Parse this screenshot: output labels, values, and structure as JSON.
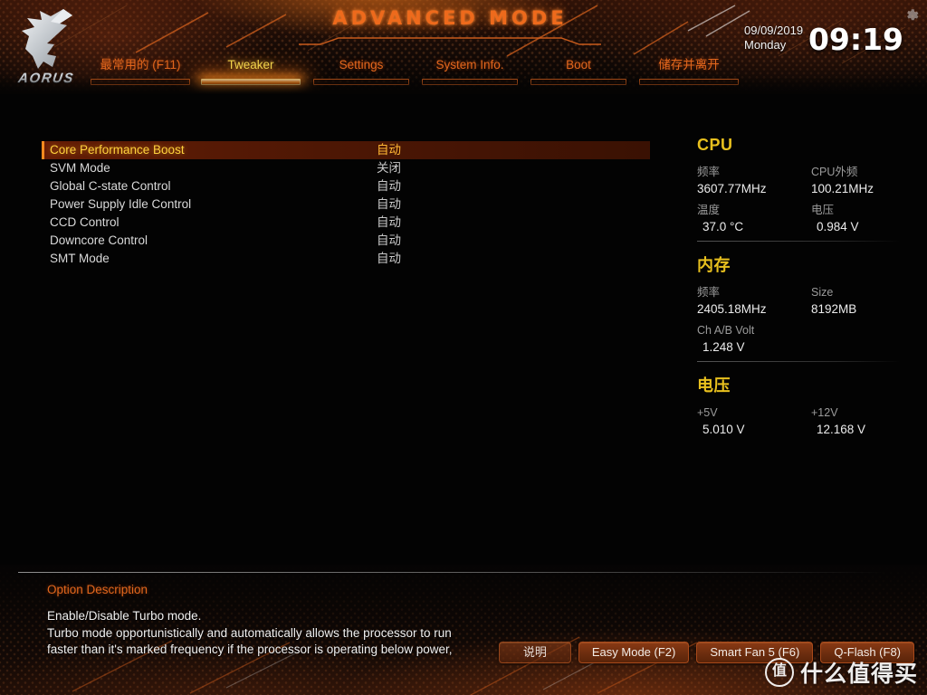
{
  "header": {
    "brand": "AORUS",
    "mode_title": "ADVANCED MODE",
    "gear_icon": "gear-icon",
    "date": "09/09/2019",
    "weekday": "Monday",
    "time": "09:19",
    "tabs": [
      {
        "label": "最常用的 (F11)",
        "active": false
      },
      {
        "label": "Tweaker",
        "active": true
      },
      {
        "label": "Settings",
        "active": false
      },
      {
        "label": "System Info.",
        "active": false
      },
      {
        "label": "Boot",
        "active": false
      },
      {
        "label": "储存并离开",
        "active": false
      }
    ]
  },
  "settings": {
    "rows": [
      {
        "name": "Core Performance Boost",
        "value": "自动",
        "selected": true
      },
      {
        "name": "SVM Mode",
        "value": "关闭",
        "selected": false
      },
      {
        "name": "Global C-state Control",
        "value": "自动",
        "selected": false
      },
      {
        "name": "Power Supply Idle Control",
        "value": "自动",
        "selected": false
      },
      {
        "name": "CCD Control",
        "value": "自动",
        "selected": false
      },
      {
        "name": "Downcore Control",
        "value": "自动",
        "selected": false
      },
      {
        "name": "SMT Mode",
        "value": "自动",
        "selected": false
      }
    ]
  },
  "sidebar": {
    "sections": [
      {
        "title": "CPU",
        "pairs": [
          {
            "k1": "频率",
            "v1": "3607.77MHz",
            "k2": "CPU外频",
            "v2": "100.21MHz"
          },
          {
            "k1": "温度",
            "v1": "37.0 °C",
            "k2": "电压",
            "v2": "0.984 V"
          }
        ]
      },
      {
        "title": "内存",
        "pairs": [
          {
            "k1": "频率",
            "v1": "2405.18MHz",
            "k2": "Size",
            "v2": "8192MB"
          },
          {
            "k1": "Ch A/B Volt",
            "v1": "1.248 V",
            "k2": "",
            "v2": ""
          }
        ]
      },
      {
        "title": "电压",
        "pairs": [
          {
            "k1": "+5V",
            "v1": "5.010 V",
            "k2": "+12V",
            "v2": "12.168 V"
          }
        ]
      }
    ]
  },
  "footer": {
    "option_description_title": "Option Description",
    "description_lines": [
      "Enable/Disable Turbo mode.",
      "Turbo mode opportunistically and automatically allows the processor to run",
      "faster than it's marked frequency if the processor is operating below power,"
    ],
    "buttons": [
      {
        "label": "说明",
        "ghost": true
      },
      {
        "label": "Easy Mode (F2)",
        "ghost": false
      },
      {
        "label": "Smart Fan 5 (F6)",
        "ghost": false
      },
      {
        "label": "Q-Flash (F8)",
        "ghost": false
      }
    ],
    "watermark_badge": "值",
    "watermark_text": "什么值得买"
  }
}
